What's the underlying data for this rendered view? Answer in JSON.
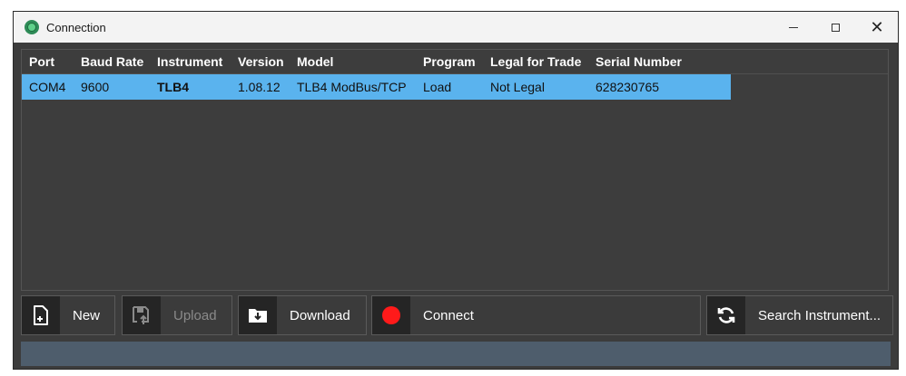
{
  "window": {
    "title": "Connection",
    "controls": {
      "minimize": "—",
      "maximize": "☐",
      "close": "✕"
    }
  },
  "table": {
    "columns": [
      "Port",
      "Baud Rate",
      "Instrument",
      "Version",
      "Model",
      "Program",
      "Legal for Trade",
      "Serial Number"
    ],
    "rows": [
      [
        "COM4",
        "9600",
        "TLB4",
        "1.08.12",
        "TLB4 ModBus/TCP",
        "Load",
        "Not Legal",
        "628230765"
      ]
    ],
    "selected_row_color": "#5ab3ee"
  },
  "buttons": {
    "new": {
      "label": "New",
      "icon": "new-file-icon"
    },
    "upload": {
      "label": "Upload",
      "icon": "save-upload-icon",
      "disabled": true
    },
    "download": {
      "label": "Download",
      "icon": "folder-download-icon"
    },
    "connect": {
      "label": "Connect",
      "icon": "red-record-icon",
      "color": "#ff1a1a"
    },
    "search": {
      "label": "Search Instrument...",
      "icon": "refresh-icon"
    }
  },
  "status": {
    "text": ""
  }
}
